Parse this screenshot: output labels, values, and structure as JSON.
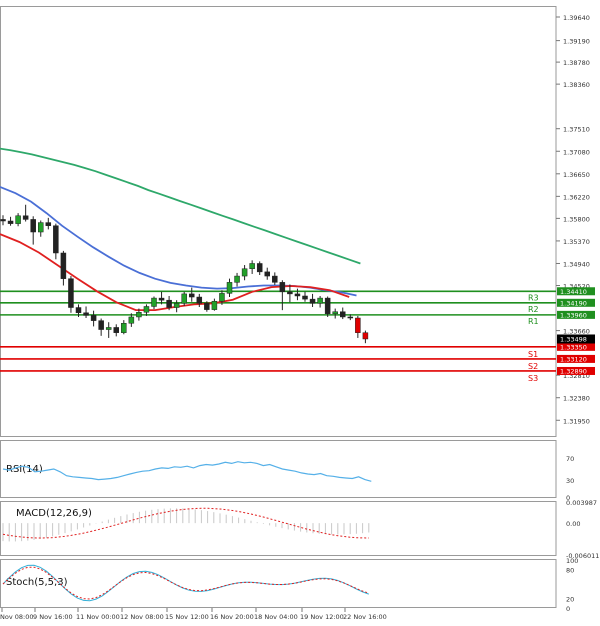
{
  "chart_data": {
    "type": "candlestick",
    "price_axis": {
      "ticks": [
        "1.39640",
        "1.39190",
        "1.38780",
        "1.38360",
        "1.37510",
        "1.37080",
        "1.36650",
        "1.36220",
        "1.35800",
        "1.35370",
        "1.34940",
        "1.34520",
        "1.33660",
        "1.32810",
        "1.32380",
        "1.31950"
      ],
      "range": [
        1.3165,
        1.3985
      ]
    },
    "time_axis": {
      "labels": [
        "Nov 08:00",
        "9 Nov 16:00",
        "11 Nov 00:00",
        "12 Nov 08:00",
        "15 Nov 12:00",
        "16 Nov 20:00",
        "18 Nov 04:00",
        "19 Nov 12:00",
        "22 Nov 16:00"
      ]
    },
    "current_price_tag": "1.33498",
    "levels": [
      {
        "name": "R3",
        "value": 1.3441,
        "tag": "1.34410",
        "color": "#1f8f1f"
      },
      {
        "name": "R2",
        "value": 1.3419,
        "tag": "1.34190",
        "color": "#1f8f1f"
      },
      {
        "name": "R1",
        "value": 1.3396,
        "tag": "1.33960",
        "color": "#1f8f1f"
      },
      {
        "name": "S1",
        "value": 1.3335,
        "tag": "1.33350",
        "color": "#e00000"
      },
      {
        "name": "S2",
        "value": 1.3312,
        "tag": "1.33120",
        "color": "#e00000"
      },
      {
        "name": "S3",
        "value": 1.3289,
        "tag": "1.32890",
        "color": "#e00000"
      }
    ],
    "candles": [
      [
        1.3578,
        1.3586,
        1.3567,
        1.3575
      ],
      [
        1.3575,
        1.3583,
        1.3566,
        1.357
      ],
      [
        1.357,
        1.359,
        1.3565,
        1.3585
      ],
      [
        1.3585,
        1.3606,
        1.3574,
        1.3578
      ],
      [
        1.3578,
        1.3584,
        1.353,
        1.3554
      ],
      [
        1.3554,
        1.3576,
        1.3545,
        1.3572
      ],
      [
        1.3572,
        1.3581,
        1.3559,
        1.3566
      ],
      [
        1.3566,
        1.357,
        1.3502,
        1.3514
      ],
      [
        1.3514,
        1.3518,
        1.3452,
        1.3465
      ],
      [
        1.3465,
        1.347,
        1.34,
        1.341
      ],
      [
        1.341,
        1.3416,
        1.3392,
        1.34
      ],
      [
        1.34,
        1.3412,
        1.339,
        1.3395
      ],
      [
        1.3395,
        1.3404,
        1.3374,
        1.3385
      ],
      [
        1.3385,
        1.3389,
        1.3356,
        1.3368
      ],
      [
        1.3368,
        1.3382,
        1.3352,
        1.3372
      ],
      [
        1.3372,
        1.3378,
        1.3355,
        1.3362
      ],
      [
        1.3362,
        1.3386,
        1.3359,
        1.338
      ],
      [
        1.338,
        1.3399,
        1.3373,
        1.3392
      ],
      [
        1.3392,
        1.3408,
        1.3385,
        1.3401
      ],
      [
        1.3401,
        1.3416,
        1.3394,
        1.3412
      ],
      [
        1.3412,
        1.3431,
        1.3407,
        1.3428
      ],
      [
        1.3428,
        1.344,
        1.3416,
        1.3424
      ],
      [
        1.3424,
        1.3432,
        1.3405,
        1.341
      ],
      [
        1.341,
        1.3424,
        1.3401,
        1.3418
      ],
      [
        1.3418,
        1.344,
        1.3413,
        1.3436
      ],
      [
        1.3436,
        1.3448,
        1.3421,
        1.343
      ],
      [
        1.343,
        1.3436,
        1.3411,
        1.3418
      ],
      [
        1.3418,
        1.3422,
        1.3402,
        1.3406
      ],
      [
        1.3406,
        1.3427,
        1.3404,
        1.3422
      ],
      [
        1.3422,
        1.3443,
        1.3415,
        1.3437
      ],
      [
        1.3437,
        1.3465,
        1.343,
        1.3458
      ],
      [
        1.3458,
        1.3476,
        1.345,
        1.347
      ],
      [
        1.347,
        1.3491,
        1.3462,
        1.3484
      ],
      [
        1.3484,
        1.35,
        1.3474,
        1.3494
      ],
      [
        1.3494,
        1.3498,
        1.3472,
        1.3478
      ],
      [
        1.3478,
        1.3486,
        1.3463,
        1.347
      ],
      [
        1.347,
        1.3477,
        1.3453,
        1.3458
      ],
      [
        1.3458,
        1.3462,
        1.3405,
        1.344
      ],
      [
        1.344,
        1.3454,
        1.342,
        1.3436
      ],
      [
        1.3436,
        1.3446,
        1.3424,
        1.3432
      ],
      [
        1.3432,
        1.344,
        1.3421,
        1.3426
      ],
      [
        1.3426,
        1.3436,
        1.3411,
        1.3418
      ],
      [
        1.3418,
        1.3432,
        1.341,
        1.3428
      ],
      [
        1.3428,
        1.3431,
        1.3392,
        1.3398
      ],
      [
        1.3398,
        1.3408,
        1.3389,
        1.3402
      ],
      [
        1.3402,
        1.341,
        1.3388,
        1.3392
      ],
      [
        1.3392,
        1.3397,
        1.3386,
        1.339
      ],
      [
        1.339,
        1.3394,
        1.3352,
        1.3362
      ],
      [
        1.3362,
        1.3366,
        1.3342,
        1.335
      ]
    ],
    "moving_averages": [
      {
        "color": "#2ea86a",
        "values": [
          1.3713,
          1.371,
          1.3706,
          1.3702,
          1.3697,
          1.3692,
          1.3687,
          1.3682,
          1.3676,
          1.367,
          1.3663,
          1.3656,
          1.3649,
          1.3642,
          1.3634,
          1.3627,
          1.362,
          1.3613,
          1.3606,
          1.3599,
          1.3592,
          1.3585,
          1.3578,
          1.3571,
          1.3564,
          1.3557,
          1.355,
          1.3543,
          1.3536,
          1.3529,
          1.3522,
          1.3515,
          1.3508,
          1.3501,
          1.3494
        ]
      },
      {
        "color": "#4a6fd6",
        "values": [
          1.364,
          1.3628,
          1.3612,
          1.359,
          1.3566,
          1.3545,
          1.3525,
          1.3507,
          1.349,
          1.3476,
          1.3465,
          1.3457,
          1.3452,
          1.3448,
          1.3446,
          1.3447,
          1.345,
          1.3452,
          1.3452,
          1.3451,
          1.3448,
          1.3443,
          1.3439,
          1.3433
        ]
      },
      {
        "color": "#e02020",
        "values": [
          1.355,
          1.3535,
          1.3515,
          1.349,
          1.3465,
          1.3441,
          1.342,
          1.3405,
          1.3405,
          1.3411,
          1.3416,
          1.3418,
          1.3425,
          1.344,
          1.3449,
          1.3451,
          1.3449,
          1.3443,
          1.343
        ]
      }
    ],
    "indicators": [
      {
        "name": "RSI(14)",
        "ticks": [
          "70",
          "30",
          "0"
        ],
        "range": [
          0,
          100
        ],
        "values": [
          50,
          48,
          52,
          55,
          53,
          45,
          46,
          48,
          50,
          45,
          38,
          36,
          35,
          34,
          33,
          31,
          32,
          33,
          35,
          38,
          41,
          44,
          46,
          47,
          50,
          52,
          51,
          54,
          53,
          55,
          52,
          56,
          58,
          57,
          59,
          62,
          60,
          63,
          61,
          62,
          60,
          56,
          58,
          54,
          50,
          48,
          46,
          43,
          41,
          40,
          42,
          38,
          37,
          35,
          34,
          33,
          36,
          31,
          28
        ]
      },
      {
        "name": "MACD(12,26,9)",
        "ticks": [
          "0.003987",
          "0.00",
          "-0.006011"
        ],
        "range": [
          -0.006011,
          0.003987
        ]
      },
      {
        "name": "Stoch(5,5,3)",
        "ticks": [
          "100",
          "80",
          "20",
          "0"
        ],
        "range": [
          0,
          100
        ]
      }
    ]
  }
}
